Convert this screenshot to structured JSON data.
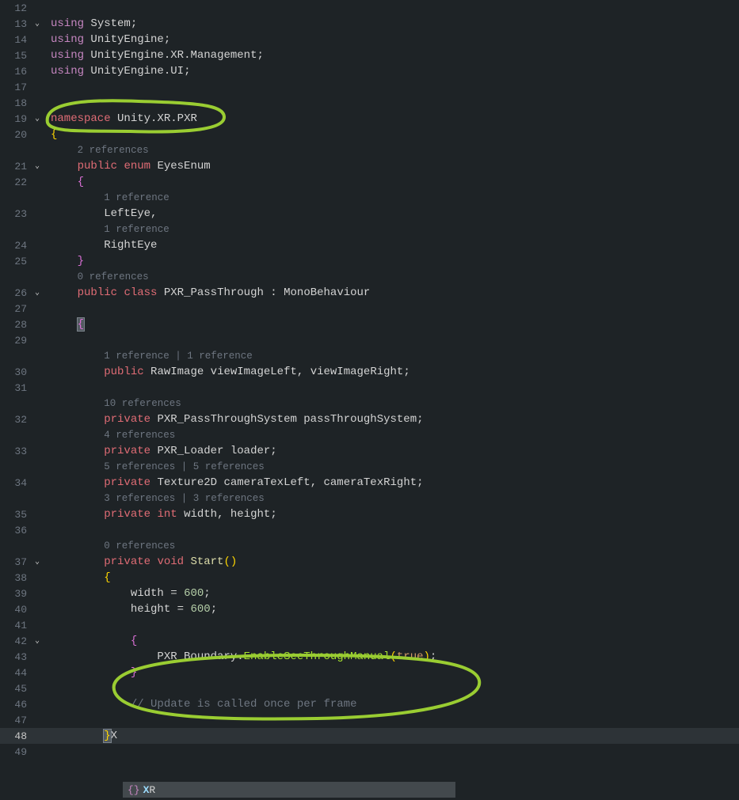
{
  "refs": {
    "r2": "2 references",
    "r1": "1 reference",
    "r1_1": "1 reference | 1 reference",
    "r0": "0 references",
    "r10": "10 references",
    "r4": "4 references",
    "r5_5": "5 references | 5 references",
    "r3_3": "3 references | 3 references"
  },
  "ln": {
    "12": "12",
    "13": "13",
    "14": "14",
    "15": "15",
    "16": "16",
    "17": "17",
    "18": "18",
    "19": "19",
    "20": "20",
    "21": "21",
    "22": "22",
    "23": "23",
    "24": "24",
    "25": "25",
    "26": "26",
    "27": "27",
    "28": "28",
    "29": "29",
    "30": "30",
    "31": "31",
    "32": "32",
    "33": "33",
    "34": "34",
    "35": "35",
    "36": "36",
    "37": "37",
    "38": "38",
    "39": "39",
    "40": "40",
    "41": "41",
    "42": "42",
    "43": "43",
    "44": "44",
    "45": "45",
    "46": "46",
    "47": "47",
    "48": "48",
    "49": "49"
  },
  "fold": {
    "open": "⌄"
  },
  "tok": {
    "using": "using",
    "namespace": "namespace",
    "public": "public",
    "enum": "enum",
    "class": "class",
    "private": "private",
    "void": "void",
    "int": "int",
    "true": "true"
  },
  "id": {
    "System": "System",
    "UnityEngine": "UnityEngine",
    "XR": "XR",
    "Management": "Management",
    "UI": "UI",
    "Unity": "Unity",
    "PXR": "PXR",
    "EyesEnum": "EyesEnum",
    "LeftEye": "LeftEye",
    "RightEye": "RightEye",
    "PXR_PassThrough": "PXR_PassThrough",
    "MonoBehaviour": "MonoBehaviour",
    "RawImage": "RawImage",
    "viewImageLeft": "viewImageLeft",
    "viewImageRight": "viewImageRight",
    "PXR_PassThroughSystem": "PXR_PassThroughSystem",
    "passThroughSystem": "passThroughSystem",
    "PXR_Loader": "PXR_Loader",
    "loader": "loader",
    "Texture2D": "Texture2D",
    "cameraTexLeft": "cameraTexLeft",
    "cameraTexRight": "cameraTexRight",
    "width": "width",
    "height": "height",
    "Start": "Start",
    "v600": "600",
    "PXR_Boundary": "PXR_Boundary",
    "EnableSeeThroughManual": "EnableSeeThroughManual",
    "X": "X"
  },
  "comment": {
    "update": "// Update is called once per frame"
  },
  "popup": {
    "prefix": "{} ",
    "match_hl": "X",
    "match_rest": "R"
  }
}
